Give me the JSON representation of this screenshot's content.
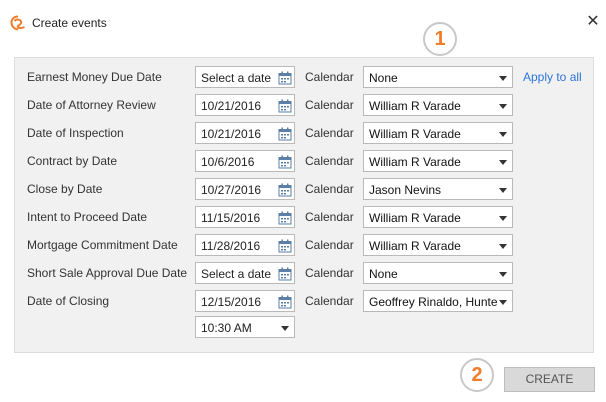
{
  "window": {
    "title": "Create events",
    "close_glyph": "✕",
    "logo_icon": "app-logo-icon"
  },
  "rows": [
    {
      "label": "Earnest Money Due Date",
      "date": "Select a date",
      "calendar_label": "Calendar",
      "calendar": "None"
    },
    {
      "label": "Date of Attorney Review",
      "date": "10/21/2016",
      "calendar_label": "Calendar",
      "calendar": "William R Varade"
    },
    {
      "label": "Date of Inspection",
      "date": "10/21/2016",
      "calendar_label": "Calendar",
      "calendar": "William R Varade"
    },
    {
      "label": "Contract by Date",
      "date": "10/6/2016",
      "calendar_label": "Calendar",
      "calendar": "William R Varade"
    },
    {
      "label": "Close by Date",
      "date": "10/27/2016",
      "calendar_label": "Calendar",
      "calendar": "Jason Nevins"
    },
    {
      "label": "Intent to Proceed Date",
      "date": "11/15/2016",
      "calendar_label": "Calendar",
      "calendar": "William R Varade"
    },
    {
      "label": "Mortgage Commitment Date",
      "date": "11/28/2016",
      "calendar_label": "Calendar",
      "calendar": "William R Varade"
    },
    {
      "label": "Short Sale Approval Due Date",
      "date": "Select a date",
      "calendar_label": "Calendar",
      "calendar": "None"
    },
    {
      "label": "Date of Closing",
      "date": "12/15/2016",
      "calendar_label": "Calendar",
      "calendar": "Geoffrey Rinaldo, Hunte"
    }
  ],
  "apply_to_all": "Apply to all",
  "closing_time": "10:30 AM",
  "markers": {
    "one": "1",
    "two": "2"
  },
  "create_label": "CREATE",
  "colors": {
    "accent": "#ef7d2b",
    "link": "#2e75d6",
    "panel": "#f1f1f1"
  }
}
